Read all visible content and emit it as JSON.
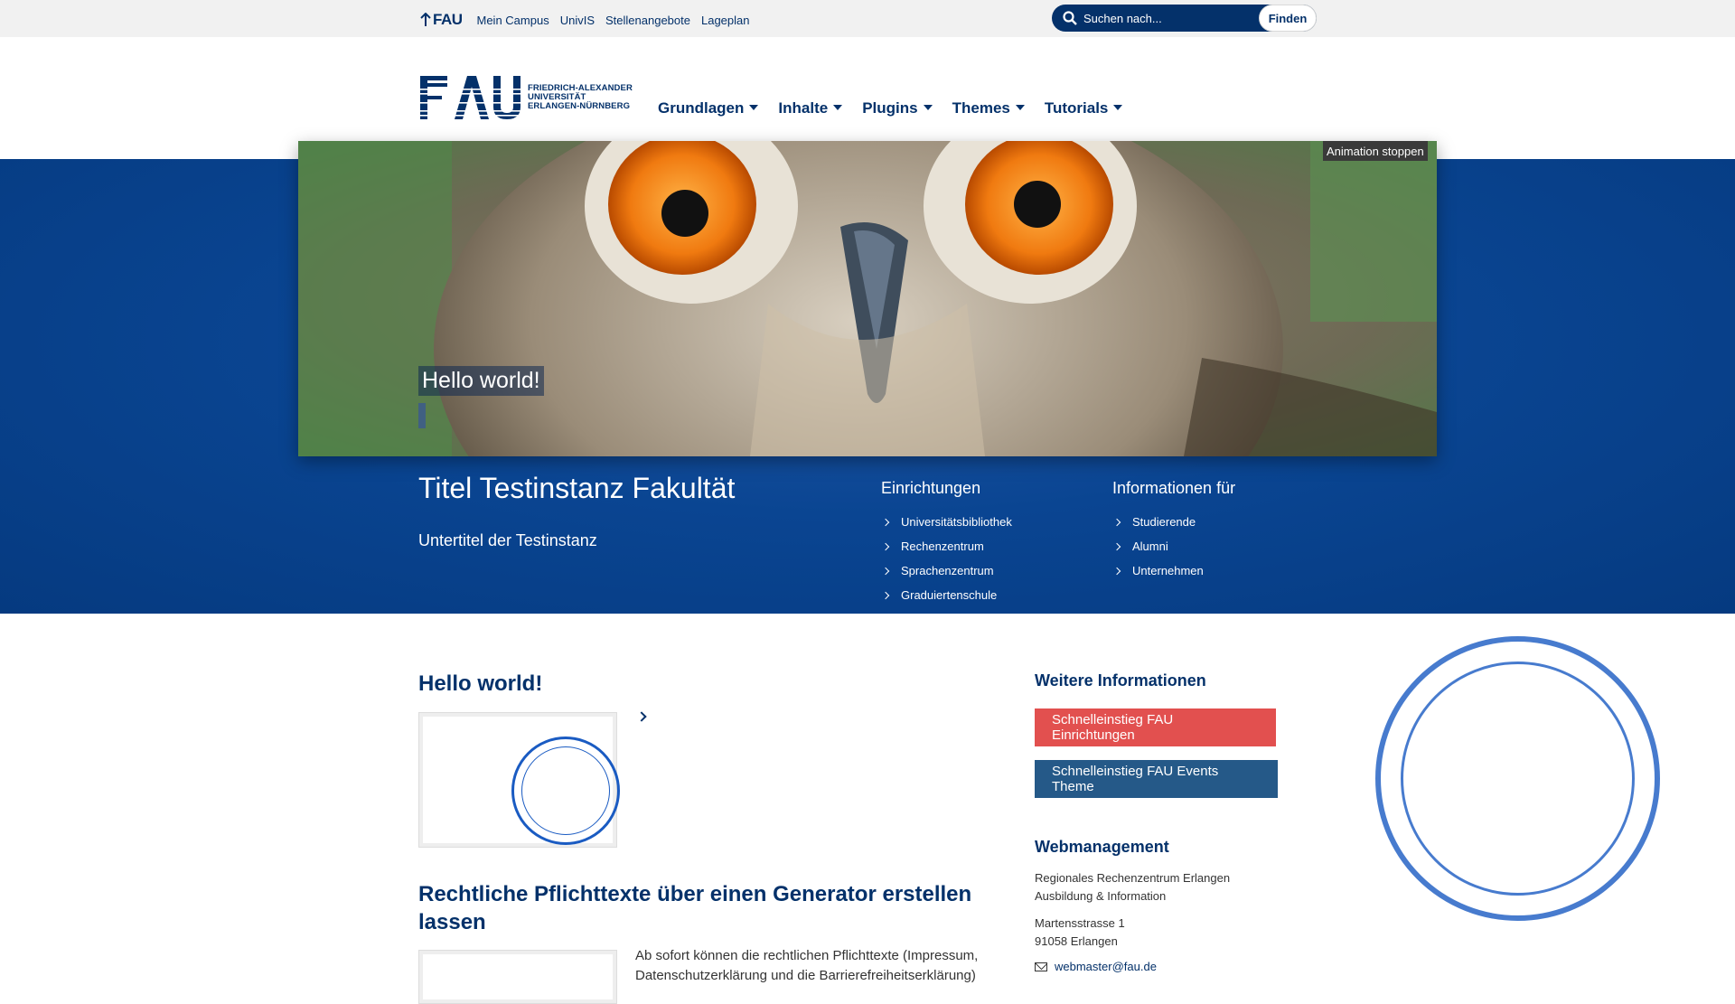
{
  "metabar": {
    "fau_link": "FAU",
    "links": [
      "Mein Campus",
      "UnivIS",
      "Stellenangebote",
      "Lageplan"
    ],
    "search_placeholder": "Suchen nach...",
    "search_button": "Finden"
  },
  "logo": {
    "lines": [
      "FRIEDRICH-ALEXANDER",
      "UNIVERSITÄT",
      "ERLANGEN-NÜRNBERG"
    ]
  },
  "mainnav": [
    "Grundlagen",
    "Inhalte",
    "Plugins",
    "Themes",
    "Tutorials"
  ],
  "slider": {
    "animation_button": "Animation stoppen",
    "slide_title": "Hello world!"
  },
  "hero": {
    "title": "Titel Testinstanz Fakultät",
    "subtitle": "Untertitel der Testinstanz",
    "einrichtungen": {
      "heading": "Einrichtungen",
      "items": [
        "Universitätsbibliothek",
        "Rechenzentrum",
        "Sprachenzentrum",
        "Graduiertenschule"
      ]
    },
    "informationen": {
      "heading": "Informationen für",
      "items": [
        "Studierende",
        "Alumni",
        "Unternehmen"
      ]
    }
  },
  "posts": [
    {
      "title": "Hello world!"
    },
    {
      "title": "Rechtliche Pflichttexte über einen Generator erstellen lassen",
      "excerpt": "Ab sofort können die rechtlichen Pflichttexte (Impressum, Datenschutzerklärung und die Barrierefreiheitserklärung)"
    }
  ],
  "sidebar": {
    "heading1": "Weitere Informationen",
    "button_red": "Schnelleinstieg FAU Einrichtungen",
    "button_blue": "Schnelleinstieg FAU Events Theme",
    "heading2": "Webmanagement",
    "address1": [
      "Regionales Rechenzentrum Erlangen",
      "Ausbildung & Information"
    ],
    "address2": [
      "Martensstrasse 1",
      "91058 Erlangen"
    ],
    "email": "webmaster@fau.de"
  },
  "colors": {
    "brand": "#04316a",
    "hero": "#0a4592",
    "red_button": "#e2504f",
    "blue_button": "#255988"
  }
}
